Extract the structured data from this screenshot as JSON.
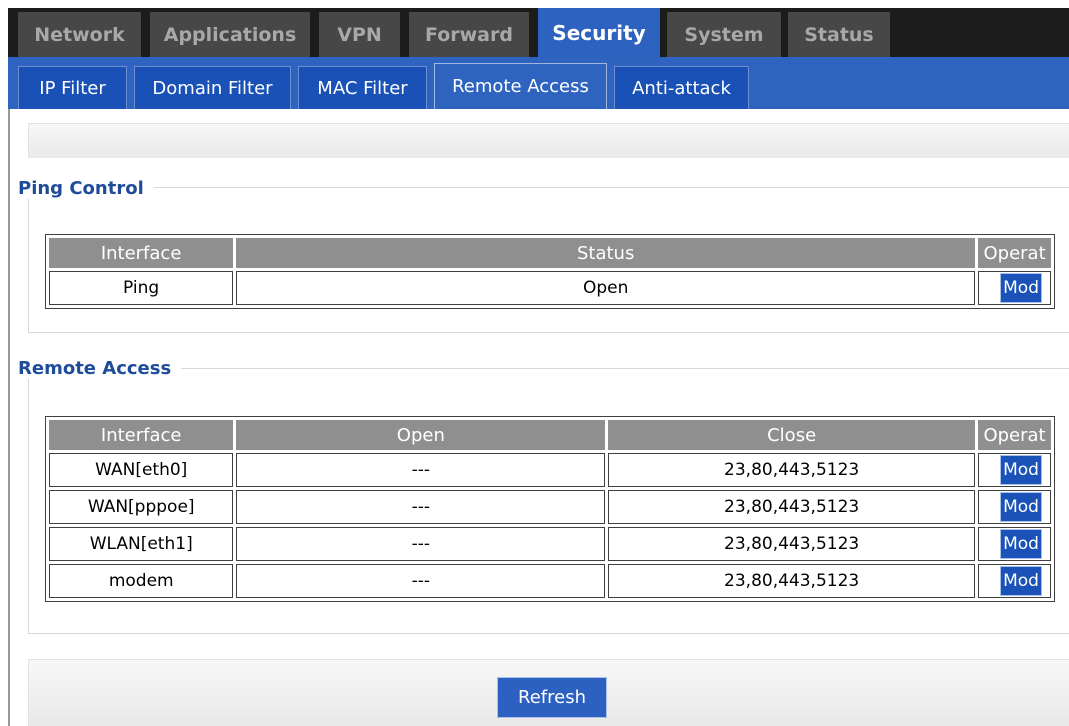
{
  "main_tabs": [
    {
      "label": "Network"
    },
    {
      "label": "Applications"
    },
    {
      "label": "VPN"
    },
    {
      "label": "Forward"
    },
    {
      "label": "Security",
      "active": true
    },
    {
      "label": "System"
    },
    {
      "label": "Status"
    }
  ],
  "sub_tabs": [
    {
      "label": "IP Filter"
    },
    {
      "label": "Domain Filter"
    },
    {
      "label": "MAC Filter"
    },
    {
      "label": "Remote Access",
      "active": true
    },
    {
      "label": "Anti-attack"
    }
  ],
  "ping_control": {
    "legend": "Ping Control",
    "headers": [
      "Interface",
      "Status",
      "Operat"
    ],
    "rows": [
      {
        "interface": "Ping",
        "status": "Open",
        "action": "Mod"
      }
    ]
  },
  "remote_access": {
    "legend": "Remote Access",
    "headers": [
      "Interface",
      "Open",
      "Close",
      "Operat"
    ],
    "rows": [
      {
        "interface": "WAN[eth0]",
        "open": "---",
        "close": "23,80,443,5123",
        "action": "Mod"
      },
      {
        "interface": "WAN[pppoe]",
        "open": "---",
        "close": "23,80,443,5123",
        "action": "Mod"
      },
      {
        "interface": "WLAN[eth1]",
        "open": "---",
        "close": "23,80,443,5123",
        "action": "Mod"
      },
      {
        "interface": "modem",
        "open": "---",
        "close": "23,80,443,5123",
        "action": "Mod"
      }
    ]
  },
  "refresh_label": "Refresh",
  "colors": {
    "nav_dark": "#1c1c1c",
    "tab_inactive": "#474747",
    "accent_blue": "#2d62c0",
    "header_gray": "#8f8f8f",
    "legend_blue": "#1f4c9a"
  }
}
